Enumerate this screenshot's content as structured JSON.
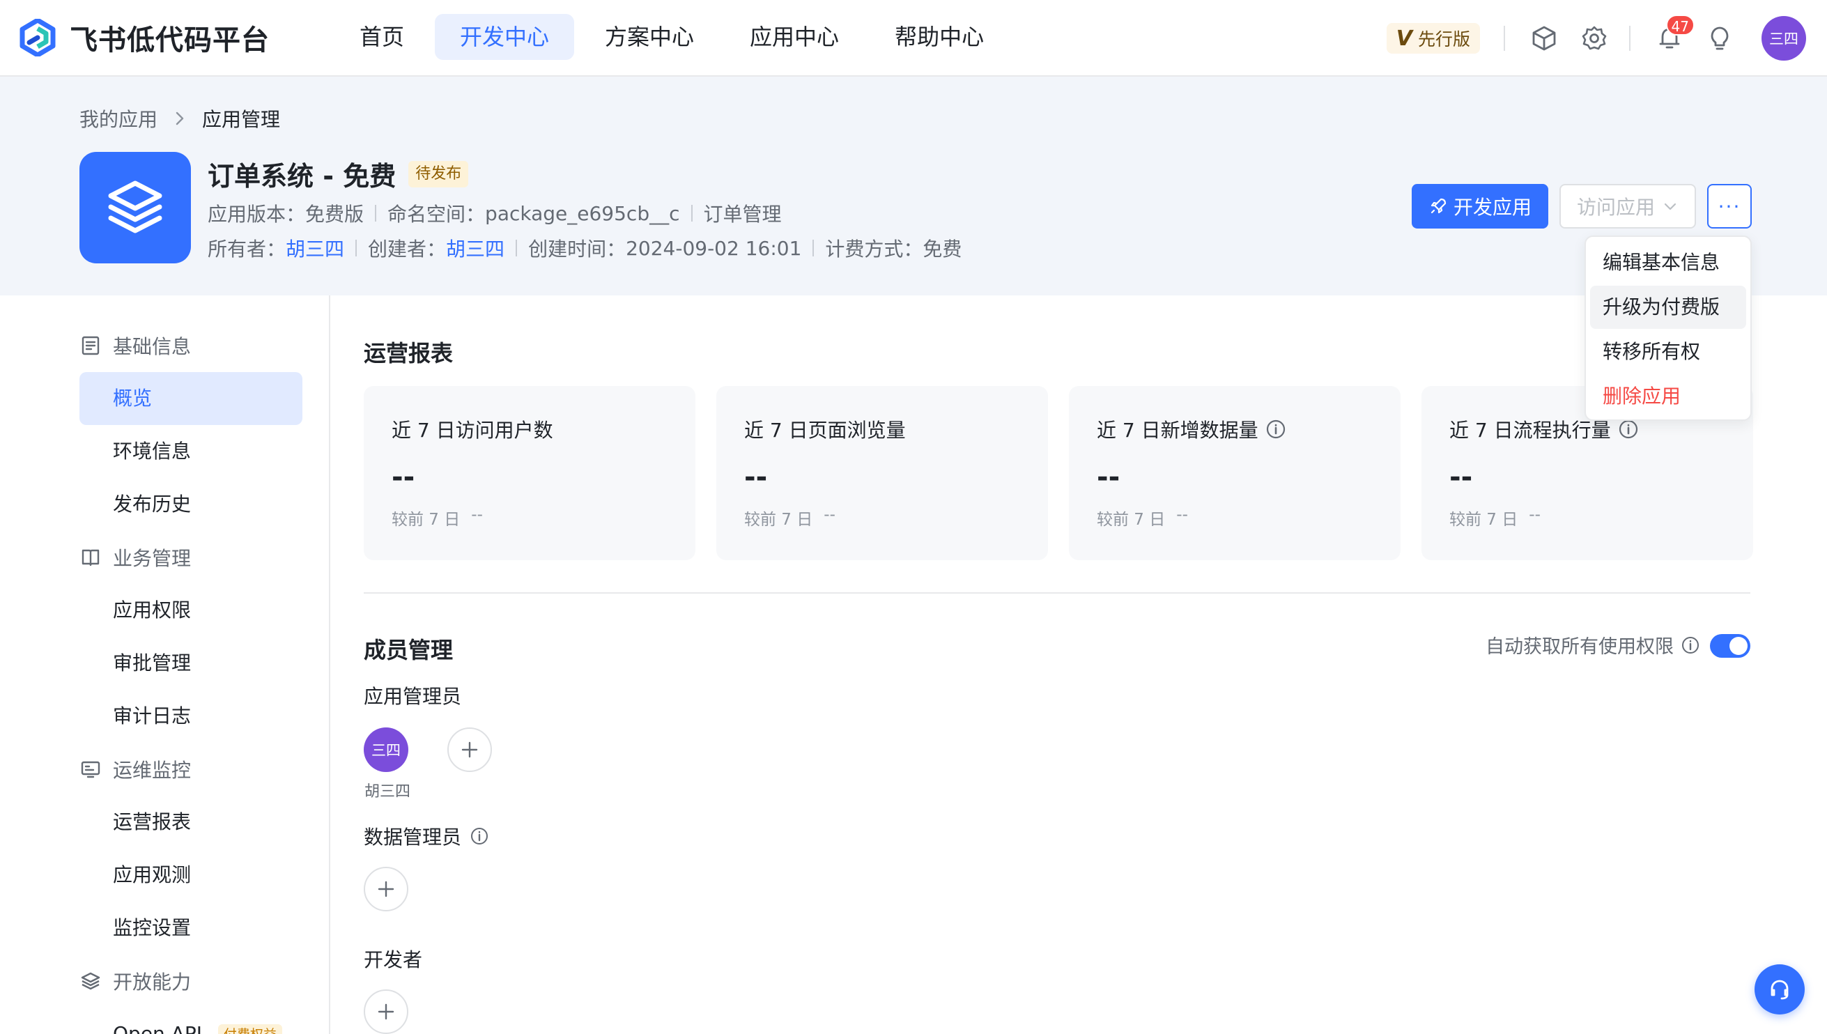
{
  "brand": {
    "name": "飞书低代码平台"
  },
  "nav": {
    "items": [
      {
        "label": "首页",
        "active": false
      },
      {
        "label": "开发中心",
        "active": true
      },
      {
        "label": "方案中心",
        "active": false
      },
      {
        "label": "应用中心",
        "active": false
      },
      {
        "label": "帮助中心",
        "active": false
      }
    ]
  },
  "toolbar": {
    "vip_label": "先行版",
    "vip_icon": "V",
    "notification_count": "47",
    "avatar_text": "三四"
  },
  "breadcrumb": {
    "parent": "我的应用",
    "current": "应用管理"
  },
  "app": {
    "title": "订单系统 - 免费",
    "status": "待发布",
    "version_label": "应用版本：",
    "version_value": "免费版",
    "namespace_label": "命名空间：",
    "namespace_value": "package_e695cb__c",
    "category": "订单管理",
    "owner_label": "所有者：",
    "owner_value": "胡三四",
    "creator_label": "创建者：",
    "creator_value": "胡三四",
    "created_label": "创建时间：",
    "created_value": "2024-09-02 16:01",
    "billing_label": "计费方式：",
    "billing_value": "免费"
  },
  "actions": {
    "develop": "开发应用",
    "visit": "访问应用",
    "more": "···"
  },
  "dropdown": {
    "items": [
      {
        "label": "编辑基本信息"
      },
      {
        "label": "升级为付费版"
      },
      {
        "label": "转移所有权"
      },
      {
        "label": "删除应用"
      }
    ]
  },
  "sidebar": {
    "groups": [
      {
        "label": "基础信息",
        "icon": "document-icon"
      },
      {
        "label": "业务管理",
        "icon": "book-icon"
      },
      {
        "label": "运维监控",
        "icon": "monitor-icon"
      },
      {
        "label": "开放能力",
        "icon": "layers-icon"
      }
    ],
    "items": [
      {
        "label": "概览"
      },
      {
        "label": "环境信息"
      },
      {
        "label": "发布历史"
      },
      {
        "label": "应用权限"
      },
      {
        "label": "审批管理"
      },
      {
        "label": "审计日志"
      },
      {
        "label": "运营报表"
      },
      {
        "label": "应用观测"
      },
      {
        "label": "监控设置"
      },
      {
        "label": "Open API",
        "tag": "付费权益"
      }
    ]
  },
  "report": {
    "title": "运营报表",
    "cards": [
      {
        "label": "近 7 日访问用户数",
        "value": "--",
        "compare_label": "较前 7 日",
        "compare_value": "--",
        "info": false
      },
      {
        "label": "近 7 日页面浏览量",
        "value": "--",
        "compare_label": "较前 7 日",
        "compare_value": "--",
        "info": false
      },
      {
        "label": "近 7 日新增数据量",
        "value": "--",
        "compare_label": "较前 7 日",
        "compare_value": "--",
        "info": true
      },
      {
        "label": "近 7 日流程执行量",
        "value": "--",
        "compare_label": "较前 7 日",
        "compare_value": "--",
        "info": true
      }
    ]
  },
  "members": {
    "title": "成员管理",
    "auto_perm_label": "自动获取所有使用权限",
    "auto_perm_on": true,
    "app_admin_label": "应用管理员",
    "admin_avatar_text": "三四",
    "admin_name": "胡三四",
    "data_admin_label": "数据管理员",
    "developer_label": "开发者"
  },
  "colors": {
    "accent": "#3370ff",
    "danger": "#f54a45",
    "avatar": "#7b4ddb"
  }
}
